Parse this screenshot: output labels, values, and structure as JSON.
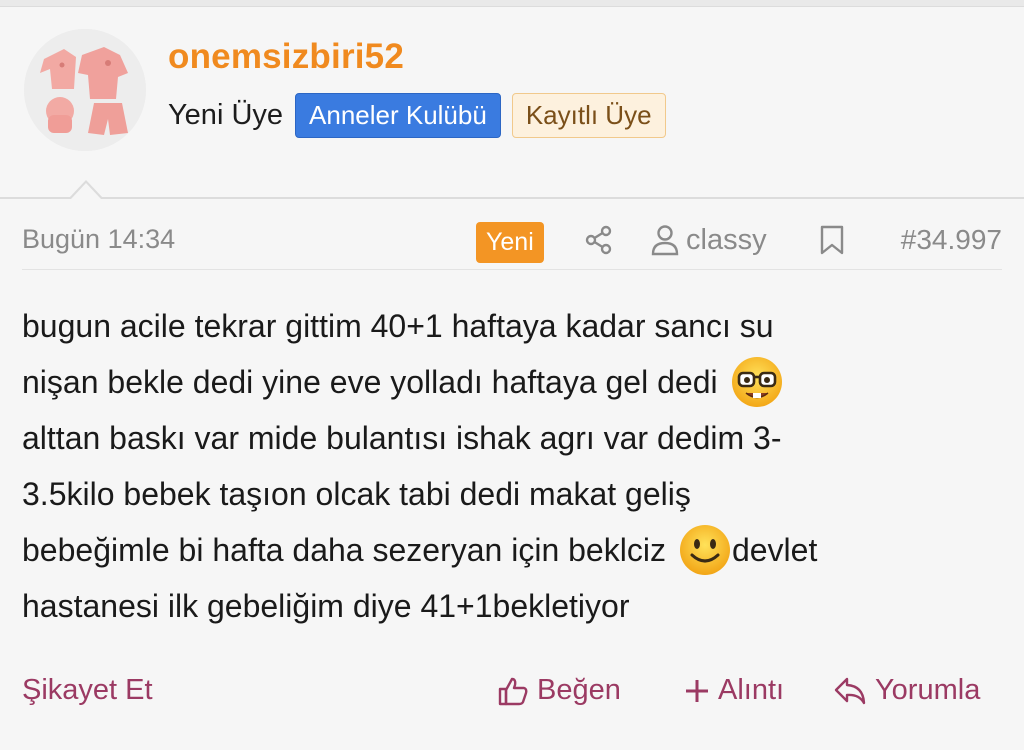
{
  "user": {
    "username": "onemsizbiri52",
    "role": "Yeni Üye",
    "badges": [
      "Anneler Kulübü",
      "Kayıtlı Üye"
    ]
  },
  "meta": {
    "time": "Bugün 14:34",
    "new_label": "Yeni",
    "viewer": "classy",
    "post_number": "#34.997"
  },
  "post": {
    "lines": [
      "bugun acile tekrar gittim 40+1 haftaya kadar sancı su",
      "nişan bekle dedi yine eve yolladı haftaya gel dedi",
      "alttan baskı var mide bulantısı ishak agrı var dedim 3-",
      "3.5kilo bebek taşıon olcak tabi dedi makat geliş",
      "bebeğimle bi hafta daha sezeryan için beklciz",
      "devlet",
      "hastanesi ilk gebeliğim diye 41+1bekletiyor"
    ]
  },
  "actions": {
    "report": "Şikayet Et",
    "like": "Beğen",
    "quote": "Alıntı",
    "reply": "Yorumla"
  },
  "colors": {
    "username": "#f08a1f",
    "badge_blue": "#3a7be0",
    "new_badge": "#f39524",
    "action": "#9b3a63"
  },
  "icons": [
    "share-icon",
    "user-icon",
    "bookmark-icon",
    "thumbs-up-icon",
    "plus-icon",
    "reply-icon",
    "nerd-face-emoji",
    "smiley-face-emoji"
  ]
}
